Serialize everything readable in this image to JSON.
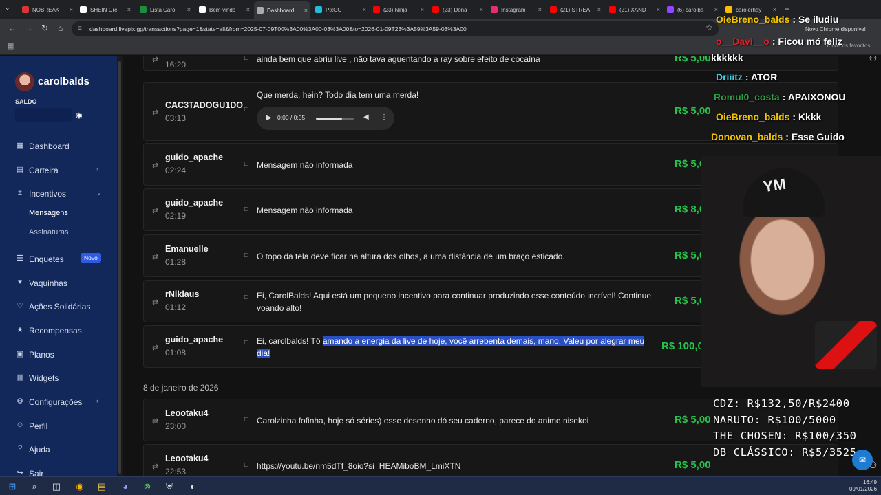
{
  "browser": {
    "tabs": [
      {
        "label": "NOBREAK",
        "color": "#d33"
      },
      {
        "label": "SHEIN Cre",
        "color": "#fff"
      },
      {
        "label": "Lista Carol",
        "color": "#1e8e3e"
      },
      {
        "label": "Bem-vindo",
        "color": "#fff"
      },
      {
        "label": "Dashboard",
        "color": "#aaa",
        "active": true
      },
      {
        "label": "PixGG",
        "color": "#2bd"
      },
      {
        "label": "(23) Ninja",
        "color": "#f00"
      },
      {
        "label": "(23) Dona",
        "color": "#f00"
      },
      {
        "label": "Instagram",
        "color": "#e1306c"
      },
      {
        "label": "(21) STREA",
        "color": "#f00"
      },
      {
        "label": "(21) XAND",
        "color": "#f00"
      },
      {
        "label": "(6) carolba",
        "color": "#9146ff"
      },
      {
        "label": "carolerhay",
        "color": "#fbbc04"
      }
    ],
    "url": "dashboard.livepix.gg/transactions?page=1&state=all&from=2025-07-09T00%3A00%3A00-03%3A00&to=2026-01-09T23%3A59%3A59-03%3A00",
    "chrome_notice": "Novo Chrome disponível",
    "bookmarks_label": "Todos os favoritos"
  },
  "sidebar": {
    "username": "carolbalds",
    "balance_label": "SALDO",
    "items": [
      {
        "label": "Dashboard",
        "icon": "▦",
        "name": "dashboard"
      },
      {
        "label": "Carteira",
        "icon": "▤",
        "name": "carteira",
        "chevron": "›"
      },
      {
        "label": "Incentivos",
        "icon": "±",
        "name": "incentivos",
        "chevron": "⌄"
      },
      {
        "label": "Enquetes",
        "icon": "☰",
        "name": "enquetes",
        "badge": "Novo"
      },
      {
        "label": "Vaquinhas",
        "icon": "♥",
        "name": "vaquinhas"
      },
      {
        "label": "Ações Solidárias",
        "icon": "♡",
        "name": "acoes-solidarias"
      },
      {
        "label": "Recompensas",
        "icon": "★",
        "name": "recompensas"
      },
      {
        "label": "Planos",
        "icon": "▣",
        "name": "planos"
      },
      {
        "label": "Widgets",
        "icon": "▥",
        "name": "widgets"
      },
      {
        "label": "Configurações",
        "icon": "⚙",
        "name": "configuracoes",
        "chevron": "›"
      },
      {
        "label": "Perfil",
        "icon": "☺",
        "name": "perfil"
      },
      {
        "label": "Ajuda",
        "icon": "?",
        "name": "ajuda"
      },
      {
        "label": "Sair",
        "icon": "↪",
        "name": "sair"
      }
    ],
    "subitems": [
      {
        "label": "Mensagens",
        "active": true
      },
      {
        "label": "Assinaturas",
        "active": false
      }
    ]
  },
  "transactions": [
    {
      "name": "",
      "time": "16:20",
      "message": "ainda bem que abriu live , não tava aguentando a ray sobre efeito de cocaína",
      "amount": "R$ 5,00"
    },
    {
      "name": "CAC3TADOGU1DO",
      "time": "03:13",
      "message": "Que merda, hein? Todo dia tem uma merda!",
      "amount": "R$ 5,00",
      "audio": "0:00 / 0:05"
    },
    {
      "name": "guido_apache",
      "time": "02:24",
      "message": "Mensagem não informada",
      "amount": "R$ 5,00"
    },
    {
      "name": "guido_apache",
      "time": "02:19",
      "message": "Mensagem não informada",
      "amount": "R$ 8,00"
    },
    {
      "name": "Emanuelle",
      "time": "01:28",
      "message": "O topo da tela deve ficar na altura dos olhos, a uma distância de um braço esticado.",
      "amount": "R$ 5,00"
    },
    {
      "name": "rNiklaus",
      "time": "01:12",
      "message": "Ei, CarolBalds! Aqui está um pequeno incentivo para continuar produzindo esse conteúdo incrível! Continue voando alto!",
      "amount": "R$ 5,00"
    },
    {
      "name": "guido_apache",
      "time": "01:08",
      "message_plain": "Ei, carolbalds! Tô ",
      "message_highlight": "amando a energia da live de hoje, você arrebenta demais, mano. Valeu por alegrar meu dia!",
      "amount": "R$ 100,00"
    },
    {
      "name": "Leootaku4",
      "time": "23:00",
      "message": "Carolzinha fofinha, hoje só séries) esse desenho dó seu caderno, parece do anime nisekoi",
      "amount": "R$ 5,00"
    },
    {
      "name": "Leootaku4",
      "time": "22:53",
      "message": "https://youtu.be/nm5dTf_8oio?si=HEAMiboBM_LmiXTN",
      "amount": "R$ 5,00"
    }
  ],
  "date_header": "8 de janeiro de 2026",
  "stream_overlay": {
    "chat": [
      {
        "user": "OieBreno_balds",
        "text": "Se iludiu",
        "color": "#f5c400"
      },
      {
        "user": "o__Davi__o",
        "text": "Ficou mó feliz",
        "color": "#e0202a"
      },
      {
        "user": "",
        "text": "kkkkkk",
        "color": "#fff"
      },
      {
        "user": "Driiitz",
        "text": "ATOR",
        "color": "#3bd0e8"
      },
      {
        "user": "Romul0_costa",
        "text": "APAIXONOU",
        "color": "#2f9e44"
      },
      {
        "user": "OieBreno_balds",
        "text": "Kkkk",
        "color": "#f5c400"
      },
      {
        "user": "Donovan_balds",
        "text": "Esse Guido",
        "color": "#f5c400"
      }
    ],
    "cap_text": "YM",
    "goals": [
      "CDZ: R$132,50/R$2400",
      "NARUTO: R$100/5000",
      "THE CHOSEN: R$100/350",
      "DB CLÁSSICO: R$5/3525"
    ]
  },
  "taskbar": {
    "time": "16:49",
    "date": "09/01/2026"
  }
}
